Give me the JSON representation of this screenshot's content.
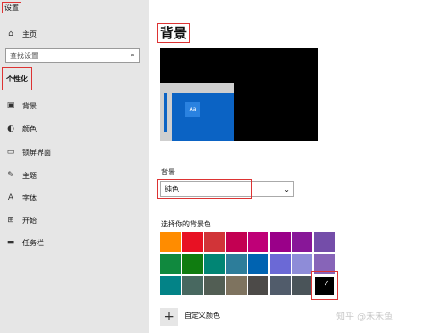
{
  "window_title": "设置",
  "sidebar": {
    "home_label": "主页",
    "search_placeholder": "查找设置",
    "section_title": "个性化",
    "items": [
      {
        "label": "背景",
        "icon": "image-icon"
      },
      {
        "label": "颜色",
        "icon": "palette-icon"
      },
      {
        "label": "锁屏界面",
        "icon": "monitor-icon"
      },
      {
        "label": "主题",
        "icon": "brush-icon"
      },
      {
        "label": "字体",
        "icon": "font-icon"
      },
      {
        "label": "开始",
        "icon": "grid-icon"
      },
      {
        "label": "任务栏",
        "icon": "taskbar-icon"
      }
    ]
  },
  "main": {
    "title": "背景",
    "preview_tile_text": "Aa",
    "background_label": "背景",
    "background_value": "纯色",
    "colors_label": "选择你的背景色",
    "custom_color_label": "自定义颜色",
    "selected_color": "#000000",
    "colors": [
      [
        "#ff8c00",
        "#e81123",
        "#d13438",
        "#c30052",
        "#bf0077",
        "#9a0089",
        "#881798",
        "#744da9"
      ],
      [
        "#10893e",
        "#107c10",
        "#018574",
        "#2d7d9a",
        "#0063b1",
        "#6b69d6",
        "#8e8cd8",
        "#8764b8"
      ],
      [
        "#038387",
        "#486860",
        "#525e54",
        "#7e735f",
        "#4c4a48",
        "#515c6b",
        "#4a5459",
        "#000000"
      ]
    ]
  },
  "watermark": "知乎 @禾禾鱼"
}
